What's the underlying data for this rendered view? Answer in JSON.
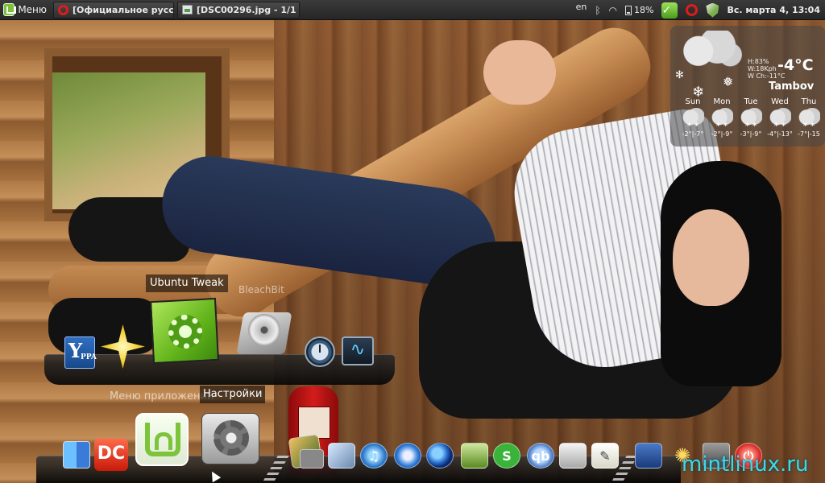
{
  "top_panel": {
    "menu_label": "Меню",
    "tasks": [
      {
        "label": "[Официальное русс...",
        "icon": "opera-icon"
      },
      {
        "label": "[DSC00296.jpg - 1/1 -...",
        "icon": "image-viewer-icon"
      }
    ],
    "tray": {
      "lang": "en",
      "battery": "18%",
      "clock": "Вс. марта  4, 13:04"
    }
  },
  "weather": {
    "details": [
      "H:83%",
      "W:18Kph",
      "W Ch:-11°C"
    ],
    "temp": "-4°C",
    "city": "Tambov",
    "forecast": [
      {
        "day": "Sun",
        "temp": "-2°|-7°"
      },
      {
        "day": "Mon",
        "temp": "-2°|-9°"
      },
      {
        "day": "Tue",
        "temp": "-3°|-9°"
      },
      {
        "day": "Wed",
        "temp": "-4°|-13°"
      },
      {
        "day": "Thu",
        "temp": "-7°|-15"
      }
    ]
  },
  "dock_upper": {
    "tooltip_active": "Ubuntu Tweak",
    "tooltip_faded": "BleachBit",
    "yppa_big": "Y",
    "yppa_small": "PPA"
  },
  "dock_lower": {
    "tooltip_faded": "Меню приложений",
    "tooltip_active": "Настройки",
    "dc_label": "DC",
    "skype_label": "S",
    "qbit_label": "qb",
    "watermark": "mintlinux.ru"
  },
  "colors": {
    "accent_mint": "#7cc43a",
    "opera_red": "#e01b1b",
    "watermark_cyan": "#3fd8e8"
  }
}
